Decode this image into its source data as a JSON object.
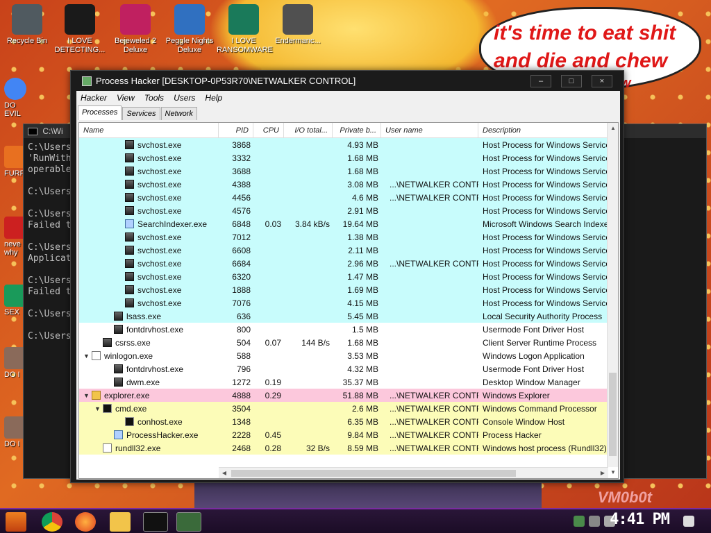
{
  "desktop": {
    "icons": [
      {
        "label": "Recycle Bin",
        "icon": "recycle-bin-icon",
        "color": "#505a60"
      },
      {
        "label": "I LOVE DETECTING...",
        "icon": "de-icon",
        "color": "#1a1a1a"
      },
      {
        "label": "Bejeweled 2 Deluxe",
        "icon": "bejeweled-icon",
        "color": "#c02060"
      },
      {
        "label": "Peggle Nights Deluxe",
        "icon": "peggle-icon",
        "color": "#3070c0"
      },
      {
        "label": "I LOVE RANSOMWARE",
        "icon": "publisher-icon",
        "color": "#1a7a5a"
      },
      {
        "label": "Endermanc...",
        "icon": "window-icon",
        "color": "#505050"
      }
    ],
    "side_icons": [
      {
        "label": "DO EVIL",
        "icon": "chrome-icon"
      },
      {
        "label": "FURF",
        "icon": "firefox-icon"
      },
      {
        "label": "neve why",
        "icon": "document-icon"
      },
      {
        "label": "SEX",
        "icon": "sex-icon"
      },
      {
        "label": "DO I",
        "icon": "face-icon"
      },
      {
        "label": "DO I",
        "icon": "face-icon-2"
      }
    ],
    "speech_line1": "it's time to eat shit",
    "speech_line2": "and die and chew",
    "speech_line3": "w",
    "watermark": "VM0b0t"
  },
  "cmd": {
    "title": "C:\\Wi",
    "lines": [
      "C:\\Users",
      "'RunWith",
      "operable",
      "",
      "C:\\Users",
      "",
      "C:\\Users",
      "Failed t",
      "",
      "C:\\Users",
      "Applicat",
      "",
      "C:\\Users",
      "Failed t",
      "",
      "C:\\Users",
      "",
      "C:\\Users"
    ]
  },
  "ph": {
    "title": "Process Hacker [DESKTOP-0P53R70\\NETWALKER CONTROL]",
    "menu": [
      "Hacker",
      "View",
      "Tools",
      "Users",
      "Help"
    ],
    "tabs": [
      "Processes",
      "Services",
      "Network"
    ],
    "columns": [
      "Name",
      "PID",
      "CPU",
      "I/O total...",
      "Private b...",
      "User name",
      "Description"
    ],
    "rows": [
      {
        "name": "svchost.exe",
        "pid": "3868",
        "cpu": "",
        "io": "",
        "priv": "4.93 MB",
        "user": "",
        "desc": "Host Process for Windows Services",
        "indent": 3,
        "bg": "cyan",
        "icon": "svc",
        "tw": ""
      },
      {
        "name": "svchost.exe",
        "pid": "3332",
        "cpu": "",
        "io": "",
        "priv": "1.68 MB",
        "user": "",
        "desc": "Host Process for Windows Services",
        "indent": 3,
        "bg": "cyan",
        "icon": "svc",
        "tw": ""
      },
      {
        "name": "svchost.exe",
        "pid": "3688",
        "cpu": "",
        "io": "",
        "priv": "1.68 MB",
        "user": "",
        "desc": "Host Process for Windows Services",
        "indent": 3,
        "bg": "cyan",
        "icon": "svc",
        "tw": ""
      },
      {
        "name": "svchost.exe",
        "pid": "4388",
        "cpu": "",
        "io": "",
        "priv": "3.08 MB",
        "user": "...\\NETWALKER CONTROL",
        "desc": "Host Process for Windows Services",
        "indent": 3,
        "bg": "cyan",
        "icon": "svc",
        "tw": ""
      },
      {
        "name": "svchost.exe",
        "pid": "4456",
        "cpu": "",
        "io": "",
        "priv": "4.6 MB",
        "user": "...\\NETWALKER CONTROL",
        "desc": "Host Process for Windows Services",
        "indent": 3,
        "bg": "cyan",
        "icon": "svc",
        "tw": ""
      },
      {
        "name": "svchost.exe",
        "pid": "4576",
        "cpu": "",
        "io": "",
        "priv": "2.91 MB",
        "user": "",
        "desc": "Host Process for Windows Services",
        "indent": 3,
        "bg": "cyan",
        "icon": "svc",
        "tw": ""
      },
      {
        "name": "SearchIndexer.exe",
        "pid": "6848",
        "cpu": "0.03",
        "io": "3.84 kB/s",
        "priv": "19.64 MB",
        "user": "",
        "desc": "Microsoft Windows Search Indexer",
        "indent": 3,
        "bg": "cyan",
        "icon": "gear",
        "tw": ""
      },
      {
        "name": "svchost.exe",
        "pid": "7012",
        "cpu": "",
        "io": "",
        "priv": "1.38 MB",
        "user": "",
        "desc": "Host Process for Windows Services",
        "indent": 3,
        "bg": "cyan",
        "icon": "svc",
        "tw": ""
      },
      {
        "name": "svchost.exe",
        "pid": "6608",
        "cpu": "",
        "io": "",
        "priv": "2.11 MB",
        "user": "",
        "desc": "Host Process for Windows Services",
        "indent": 3,
        "bg": "cyan",
        "icon": "svc",
        "tw": ""
      },
      {
        "name": "svchost.exe",
        "pid": "6684",
        "cpu": "",
        "io": "",
        "priv": "2.96 MB",
        "user": "...\\NETWALKER CONTROL",
        "desc": "Host Process for Windows Services",
        "indent": 3,
        "bg": "cyan",
        "icon": "svc",
        "tw": ""
      },
      {
        "name": "svchost.exe",
        "pid": "6320",
        "cpu": "",
        "io": "",
        "priv": "1.47 MB",
        "user": "",
        "desc": "Host Process for Windows Services",
        "indent": 3,
        "bg": "cyan",
        "icon": "svc",
        "tw": ""
      },
      {
        "name": "svchost.exe",
        "pid": "1888",
        "cpu": "",
        "io": "",
        "priv": "1.69 MB",
        "user": "",
        "desc": "Host Process for Windows Services",
        "indent": 3,
        "bg": "cyan",
        "icon": "svc",
        "tw": ""
      },
      {
        "name": "svchost.exe",
        "pid": "7076",
        "cpu": "",
        "io": "",
        "priv": "4.15 MB",
        "user": "",
        "desc": "Host Process for Windows Services",
        "indent": 3,
        "bg": "cyan",
        "icon": "svc",
        "tw": ""
      },
      {
        "name": "lsass.exe",
        "pid": "636",
        "cpu": "",
        "io": "",
        "priv": "5.45 MB",
        "user": "",
        "desc": "Local Security Authority Process",
        "indent": 2,
        "bg": "cyan",
        "icon": "svc",
        "tw": ""
      },
      {
        "name": "fontdrvhost.exe",
        "pid": "800",
        "cpu": "",
        "io": "",
        "priv": "1.5 MB",
        "user": "",
        "desc": "Usermode Font Driver Host",
        "indent": 2,
        "bg": "white",
        "icon": "svc",
        "tw": ""
      },
      {
        "name": "csrss.exe",
        "pid": "504",
        "cpu": "0.07",
        "io": "144 B/s",
        "priv": "1.68 MB",
        "user": "",
        "desc": "Client Server Runtime Process",
        "indent": 1,
        "bg": "white",
        "icon": "svc",
        "tw": ""
      },
      {
        "name": "winlogon.exe",
        "pid": "588",
        "cpu": "",
        "io": "",
        "priv": "3.53 MB",
        "user": "",
        "desc": "Windows Logon Application",
        "indent": 0,
        "bg": "white",
        "icon": "doc",
        "tw": "▼"
      },
      {
        "name": "fontdrvhost.exe",
        "pid": "796",
        "cpu": "",
        "io": "",
        "priv": "4.32 MB",
        "user": "",
        "desc": "Usermode Font Driver Host",
        "indent": 2,
        "bg": "white",
        "icon": "svc",
        "tw": ""
      },
      {
        "name": "dwm.exe",
        "pid": "1272",
        "cpu": "0.19",
        "io": "",
        "priv": "35.37 MB",
        "user": "",
        "desc": "Desktop Window Manager",
        "indent": 2,
        "bg": "white",
        "icon": "svc",
        "tw": ""
      },
      {
        "name": "explorer.exe",
        "pid": "4888",
        "cpu": "0.29",
        "io": "",
        "priv": "51.88 MB",
        "user": "...\\NETWALKER CONTROL",
        "desc": "Windows Explorer",
        "indent": 0,
        "bg": "pink",
        "icon": "folder",
        "tw": "▼"
      },
      {
        "name": "cmd.exe",
        "pid": "3504",
        "cpu": "",
        "io": "",
        "priv": "2.6 MB",
        "user": "...\\NETWALKER CONTROL",
        "desc": "Windows Command Processor",
        "indent": 1,
        "bg": "yellow",
        "icon": "console",
        "tw": "▼"
      },
      {
        "name": "conhost.exe",
        "pid": "1348",
        "cpu": "",
        "io": "",
        "priv": "6.35 MB",
        "user": "...\\NETWALKER CONTROL",
        "desc": "Console Window Host",
        "indent": 3,
        "bg": "yellow",
        "icon": "console",
        "tw": ""
      },
      {
        "name": "ProcessHacker.exe",
        "pid": "2228",
        "cpu": "0.45",
        "io": "",
        "priv": "9.84 MB",
        "user": "...\\NETWALKER CONTROL",
        "desc": "Process Hacker",
        "indent": 2,
        "bg": "yellow",
        "icon": "gear",
        "tw": ""
      },
      {
        "name": "rundll32.exe",
        "pid": "2468",
        "cpu": "0.28",
        "io": "32 B/s",
        "priv": "8.59 MB",
        "user": "...\\NETWALKER CONTROL",
        "desc": "Windows host process (Rundll32)",
        "indent": 1,
        "bg": "yellow",
        "icon": "doc",
        "tw": ""
      }
    ],
    "row_colors": {
      "cyan": "#c8fcfc",
      "white": "#ffffff",
      "pink": "#fcc8dc",
      "yellow": "#fcfcb8"
    }
  },
  "taskbar": {
    "clock": "4:41 PM"
  }
}
